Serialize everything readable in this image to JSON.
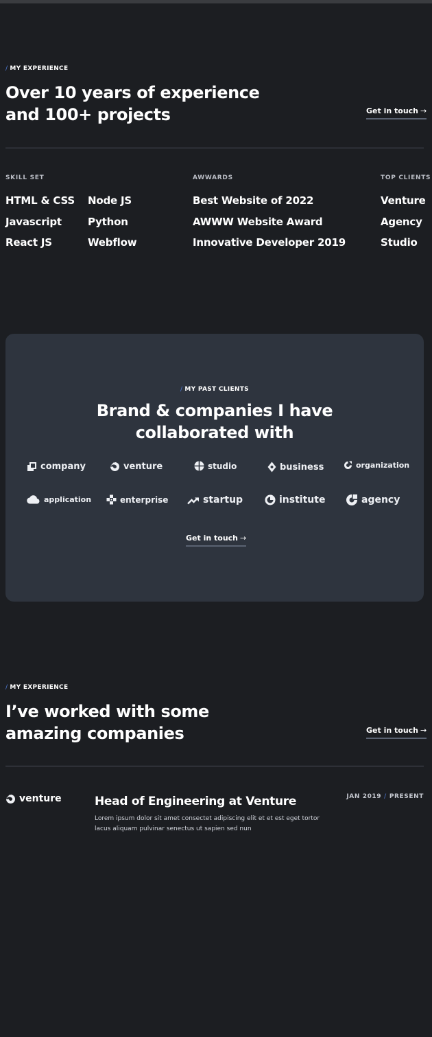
{
  "experience_section": {
    "eyebrow": "MY EXPERIENCE",
    "title_line1": "Over 10 years of experience",
    "title_line2": "and 100+ projects",
    "cta": "Get in touch",
    "skills": {
      "label": "SKILL SET",
      "col1": [
        "HTML & CSS",
        "Javascript",
        "React JS"
      ],
      "col2": [
        "Node JS",
        "Python",
        "Webflow"
      ]
    },
    "awards": {
      "label": "AWWARDS",
      "items": [
        "Best Website of 2022",
        "AWWW Website Award",
        "Innovative Developer 2019"
      ]
    },
    "top_clients": {
      "label": "TOP CLIENTS",
      "items": [
        "Venture",
        "Agency",
        "Studio"
      ]
    }
  },
  "clients_section": {
    "eyebrow": "MY PAST CLIENTS",
    "title_line1": "Brand & companies I have",
    "title_line2": "collaborated with",
    "logos": [
      {
        "name": "company",
        "icon": "company-icon"
      },
      {
        "name": "venture",
        "icon": "venture-icon"
      },
      {
        "name": "studio",
        "icon": "studio-icon"
      },
      {
        "name": "business",
        "icon": "business-icon"
      },
      {
        "name": "organization",
        "icon": "organization-icon"
      },
      {
        "name": "application",
        "icon": "cloud-icon"
      },
      {
        "name": "enterprise",
        "icon": "enterprise-icon"
      },
      {
        "name": "startup",
        "icon": "trend-icon"
      },
      {
        "name": "institute",
        "icon": "institute-icon"
      },
      {
        "name": "agency",
        "icon": "agency-icon"
      }
    ],
    "cta": "Get in touch"
  },
  "companies_section": {
    "eyebrow": "MY EXPERIENCE",
    "title_line1": "I’ve worked with some",
    "title_line2": "amazing companies",
    "cta": "Get in touch",
    "jobs": [
      {
        "company": "venture",
        "title": "Head of Engineering at Venture",
        "description": "Lorem ipsum dolor sit amet consectet adipiscing elit et et est eget tortor lacus aliquam pulvinar senectus ut sapien sed nun",
        "start": "JAN 2019",
        "end": "PRESENT"
      }
    ]
  },
  "colors": {
    "background": "#1c1e22",
    "card": "#2e343e",
    "accent_slash": "#4f7bd8",
    "divider": "#4a4e5a"
  }
}
